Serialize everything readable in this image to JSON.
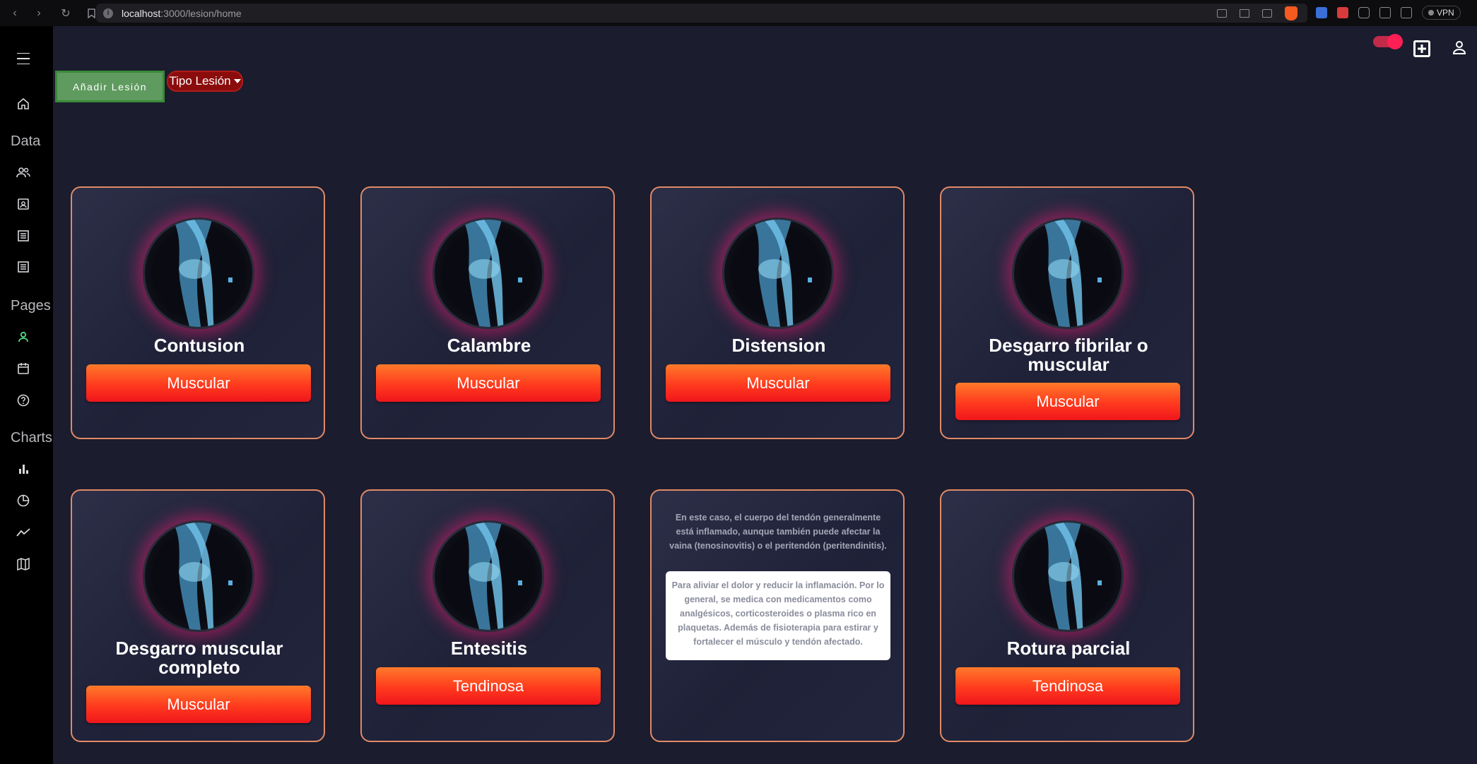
{
  "browser": {
    "url_host": "localhost",
    "url_path": ":3000/lesion/home",
    "vpn_label": "VPN"
  },
  "sidebar": {
    "sections": [
      {
        "label": "Data"
      },
      {
        "label": "Pages"
      },
      {
        "label": "Charts"
      }
    ]
  },
  "toolbar": {
    "add_label": "Añadir Lesión",
    "type_label": "Tipo Lesión"
  },
  "cards": [
    {
      "title": "Contusion",
      "type": "Muscular"
    },
    {
      "title": "Calambre",
      "type": "Muscular"
    },
    {
      "title": "Distension",
      "type": "Muscular"
    },
    {
      "title": "Desgarro fibrilar o muscular",
      "type": "Muscular"
    },
    {
      "title": "Desgarro muscular completo",
      "type": "Muscular"
    },
    {
      "title": "Entesitis",
      "type": "Tendinosa"
    },
    {
      "title": "",
      "type": "",
      "description": "En este caso, el cuerpo del tendón generalmente está inflamado, aunque también puede afectar la vaina (tenosinovitis) o el peritendón (peritendinitis).",
      "treatment": "Para aliviar el dolor y reducir la inflamación. Por lo general, se medica con medicamentos como analgésicos, corticosteroides o plasma rico en plaquetas. Además de fisioterapia para estirar y fortalecer el músculo y tendón afectado."
    },
    {
      "title": "Rotura parcial",
      "type": "Tendinosa"
    }
  ],
  "colors": {
    "accent": "#ff3a1e",
    "card_border": "#e08a66",
    "add_button": "#5f9a5f",
    "type_dropdown": "#8b0c0c",
    "toggle": "#ff1f55"
  }
}
